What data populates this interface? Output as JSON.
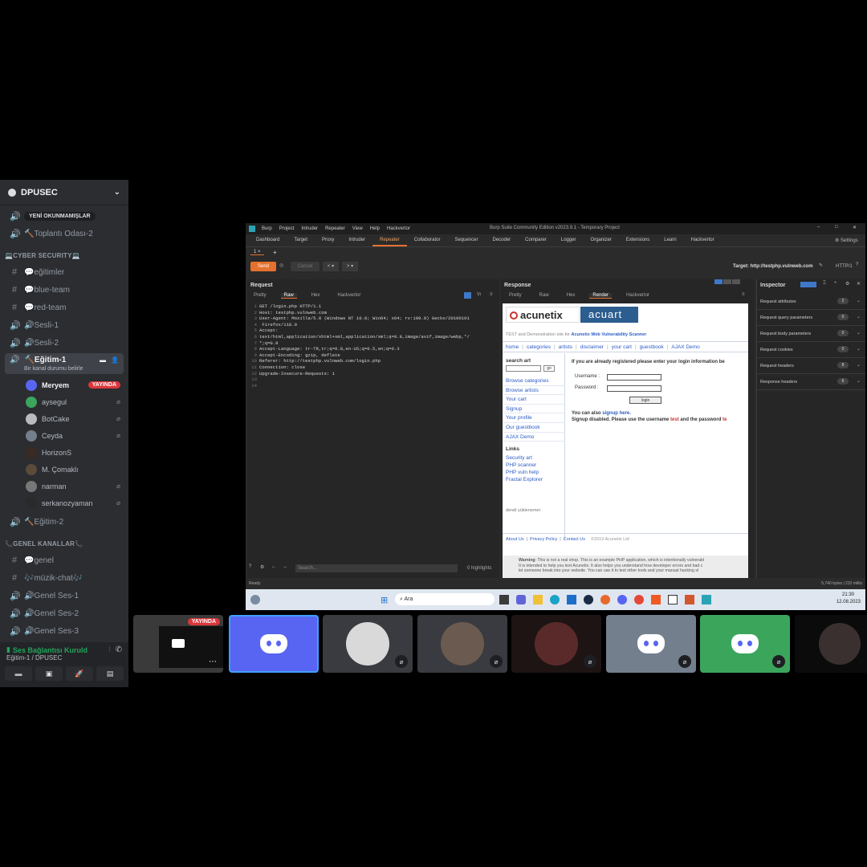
{
  "server": {
    "name": "DPUSEC"
  },
  "channels_top": [
    {
      "type": "voice",
      "label": "YENİ OKUNMAMIŞLAR",
      "pill": true
    },
    {
      "type": "voice",
      "label": "🔨Toplantı Odası-2"
    }
  ],
  "categories": {
    "cyber": "💻CYBER SECURITY💻",
    "genel": "📞GENEL KANALLAR📞"
  },
  "cyber_channels": [
    {
      "type": "text",
      "label": "💬eğitimler"
    },
    {
      "type": "text",
      "label": "💬blue-team"
    },
    {
      "type": "text",
      "label": "💬red-team"
    },
    {
      "type": "voice",
      "label": "🔊Sesli-1"
    },
    {
      "type": "voice",
      "label": "🔊Sesli-2"
    }
  ],
  "active_channel": {
    "label": "🔨Eğitim-1",
    "status": "Bir kanal durumu belirle"
  },
  "voice_users": [
    {
      "name": "Meryem",
      "live": "YAYINDA",
      "color": "#5865f2"
    },
    {
      "name": "aysegul",
      "color": "#3ba55c"
    },
    {
      "name": "BotCake",
      "color": "#b9bbbe"
    },
    {
      "name": "Ceyda",
      "color": "#747f8d"
    },
    {
      "name": "HorizonS",
      "color": "#3a2a22"
    },
    {
      "name": "M. Çomaklı",
      "color": "#5c4a3a"
    },
    {
      "name": "narman",
      "color": "#777"
    },
    {
      "name": "serkanozyaman",
      "color": "#2a2a2a"
    }
  ],
  "after_channels": [
    {
      "type": "voice",
      "label": "🔨Eğitim-2"
    }
  ],
  "genel_channels": [
    {
      "type": "text",
      "label": "💬genel"
    },
    {
      "type": "text",
      "label": "🎶müzik-chat🎶"
    },
    {
      "type": "voice",
      "label": "🔊Genel Ses-1"
    },
    {
      "type": "voice",
      "label": "🔊Genel Ses-2"
    },
    {
      "type": "voice",
      "label": "🔊Genel Ses-3"
    }
  ],
  "voice_status": {
    "title": "Ses Bağlantısı Kuruld",
    "sub": "Eğitim-1 / DPUSEC"
  },
  "burp": {
    "menu": [
      "Burp",
      "Project",
      "Intruder",
      "Repeater",
      "View",
      "Help",
      "Hackvertor"
    ],
    "title": "Burp Suite Community Edition v2023.9.1 - Temporary Project",
    "tabs": [
      "Dashboard",
      "Target",
      "Proxy",
      "Intruder",
      "Repeater",
      "Collaborator",
      "Sequencer",
      "Decoder",
      "Comparer",
      "Logger",
      "Organizer",
      "Extensions",
      "Learn",
      "Hackvertor"
    ],
    "active_tab": "Repeater",
    "settings": "Settings",
    "subtab": "1 ×",
    "send": "Send",
    "cancel": "Cancel",
    "target": "Target: http://testphp.vulnweb.com",
    "http": "HTTP/1",
    "request_title": "Request",
    "response_title": "Response",
    "req_tabs": [
      "Pretty",
      "Raw",
      "Hex",
      "Hackvertor"
    ],
    "resp_tabs": [
      "Pretty",
      "Raw",
      "Hex",
      "Render",
      "Hackvertor"
    ],
    "request_lines": [
      "GET /login.php HTTP/1.1",
      "Host: testphp.vulnweb.com",
      "User-Agent: Mozilla/5.0 (Windows NT 10.0; Win64; x64; rv:109.0) Gecko/20100101",
      " Firefox/118.0",
      "Accept:",
      "text/html,application/xhtml+xml,application/xml;q=0.9,image/avif,image/webp,*/",
      "*;q=0.8",
      "Accept-Language: tr-TR,tr;q=0.8,en-US;q=0.5,en;q=0.3",
      "Accept-Encoding: gzip, deflate",
      "Referer: http://testphp.vulnweb.com/login.php",
      "Connection: close",
      "Upgrade-Insecure-Requests: 1",
      "",
      ""
    ],
    "search": "Search...",
    "highlights": "0 highlights",
    "inspector_title": "Inspector",
    "inspector_rows": [
      {
        "label": "Request attributes",
        "count": "2"
      },
      {
        "label": "Request query parameters",
        "count": "0"
      },
      {
        "label": "Request body parameters",
        "count": "0"
      },
      {
        "label": "Request cookies",
        "count": "0"
      },
      {
        "label": "Request headers",
        "count": "8"
      },
      {
        "label": "Response headers",
        "count": "6"
      }
    ],
    "status_left": "Ready",
    "status_right": "5,740 bytes | 232 millis"
  },
  "render": {
    "logo1": "acunetix",
    "logo2": "acuart",
    "tagline_prefix": "TEST and Demonstration site for",
    "tagline_brand": "Acunetix Web Vulnerability Scanner",
    "nav": [
      "home",
      "categories",
      "artists",
      "disclaimer",
      "your cart",
      "guestbook",
      "AJAX Demo"
    ],
    "search_label": "search art",
    "go": "go",
    "side_links": [
      "Browse categories",
      "Browse artists",
      "Your cart",
      "Signup",
      "Your profile",
      "Our guestbook",
      "AJAX Demo"
    ],
    "links_heading": "Links",
    "links": [
      "Security art",
      "PHP scanner",
      "PHP vuln help",
      "Fractal Explorer"
    ],
    "loading": "dendi yüklenemer",
    "login_intro": "If you are already registered please enter your login information be",
    "username": "Username :",
    "password": "Password :",
    "login_btn": "login",
    "also_prefix": "You can also",
    "also_link": "signup here.",
    "signup_disabled_a": "Signup disabled. Please use the username",
    "signup_test": "test",
    "signup_disabled_b": "and the password",
    "signup_i": "te",
    "footer_links": [
      "About Us",
      "Privacy Policy",
      "Contact Us"
    ],
    "copyright": "©2019 Acunetix Ltd",
    "warning_label": "Warning",
    "warning_text_1": "This is not a real shop. This is an example PHP application, which is intentionally vulnerabl",
    "warning_text_2": "It is intended to help you test Acunetix. It also helps you understand how developer errors and bad c",
    "warning_text_3": "let someone break into your website. You can use it to test other tools and your manual hacking sl"
  },
  "taskbar": {
    "search": "Ara",
    "time": "21:30",
    "date": "12.08.2023"
  },
  "tiles": {
    "live": "YAYINDA"
  }
}
